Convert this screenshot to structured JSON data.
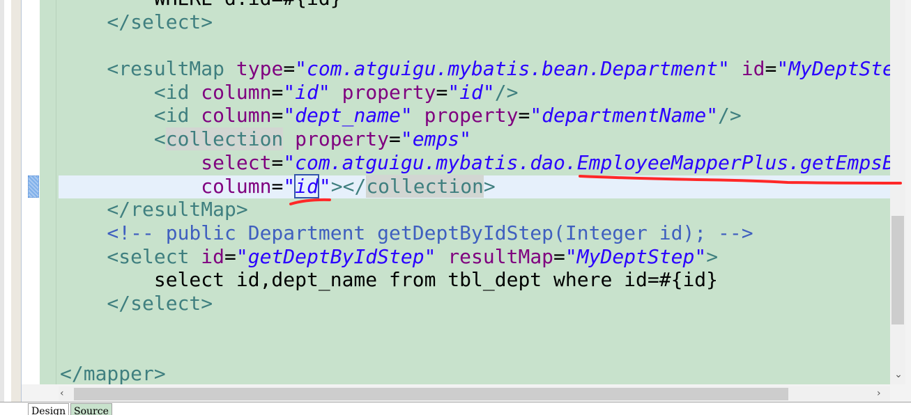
{
  "editor": {
    "lines": [
      [
        {
          "t": "        WHERE d.id=#{id}",
          "c": "txt"
        }
      ],
      [
        {
          "t": "    </select>",
          "c": "tag"
        }
      ],
      [],
      [
        {
          "t": "    <resultMap ",
          "c": "tag"
        },
        {
          "t": "type",
          "c": "attr"
        },
        {
          "t": "=",
          "c": "txt"
        },
        {
          "t": "\"com.atguigu.mybatis.bean.Department\"",
          "c": "val"
        },
        {
          "t": " ",
          "c": "txt"
        },
        {
          "t": "id",
          "c": "attr"
        },
        {
          "t": "=",
          "c": "txt"
        },
        {
          "t": "\"MyDeptStep\">",
          "c": "val"
        }
      ],
      [
        {
          "t": "        <id ",
          "c": "tag"
        },
        {
          "t": "column",
          "c": "attr"
        },
        {
          "t": "=",
          "c": "txt"
        },
        {
          "t": "\"id\"",
          "c": "val"
        },
        {
          "t": " ",
          "c": "txt"
        },
        {
          "t": "property",
          "c": "attr"
        },
        {
          "t": "=",
          "c": "txt"
        },
        {
          "t": "\"id\"",
          "c": "val"
        },
        {
          "t": "/>",
          "c": "tag"
        }
      ],
      [
        {
          "t": "        <id ",
          "c": "tag"
        },
        {
          "t": "column",
          "c": "attr"
        },
        {
          "t": "=",
          "c": "txt"
        },
        {
          "t": "\"dept_name\"",
          "c": "val"
        },
        {
          "t": " ",
          "c": "txt"
        },
        {
          "t": "property",
          "c": "attr"
        },
        {
          "t": "=",
          "c": "txt"
        },
        {
          "t": "\"departmentName\"",
          "c": "val"
        },
        {
          "t": "/>",
          "c": "tag"
        }
      ],
      [
        {
          "t": "        <",
          "c": "tag"
        },
        {
          "t": "collection",
          "c": "tag hl"
        },
        {
          "t": " ",
          "c": "txt"
        },
        {
          "t": "property",
          "c": "attr"
        },
        {
          "t": "=",
          "c": "txt"
        },
        {
          "t": "\"emps\"",
          "c": "val"
        }
      ],
      [
        {
          "t": "            ",
          "c": "txt"
        },
        {
          "t": "select",
          "c": "attr"
        },
        {
          "t": "=",
          "c": "txt"
        },
        {
          "t": "\"com.atguigu.mybatis.dao.EmployeeMapperPlus.getEmpsByDeptId\"",
          "c": "val"
        }
      ],
      [
        {
          "t": "            ",
          "c": "txt"
        },
        {
          "t": "column",
          "c": "attr"
        },
        {
          "t": "=",
          "c": "txt"
        },
        {
          "t": "\"",
          "c": "val"
        },
        {
          "t": "id",
          "c": "val box"
        },
        {
          "t": "|",
          "c": "caret"
        },
        {
          "t": "\"",
          "c": "val"
        },
        {
          "t": "></",
          "c": "tag"
        },
        {
          "t": "collection",
          "c": "tag hl"
        },
        {
          "t": ">",
          "c": "tag"
        }
      ],
      [
        {
          "t": "    </resultMap>",
          "c": "tag"
        }
      ],
      [
        {
          "t": "    <!-- public Department getDeptByIdStep(Integer id); -->",
          "c": "cmt"
        }
      ],
      [
        {
          "t": "    <select ",
          "c": "tag"
        },
        {
          "t": "id",
          "c": "attr"
        },
        {
          "t": "=",
          "c": "txt"
        },
        {
          "t": "\"getDeptByIdStep\"",
          "c": "val"
        },
        {
          "t": " ",
          "c": "txt"
        },
        {
          "t": "resultMap",
          "c": "attr"
        },
        {
          "t": "=",
          "c": "txt"
        },
        {
          "t": "\"MyDeptStep\"",
          "c": "val"
        },
        {
          "t": ">",
          "c": "tag"
        }
      ],
      [
        {
          "t": "        select id,dept_name from tbl_dept where id=#{id}",
          "c": "txt"
        }
      ],
      [
        {
          "t": "    </select>",
          "c": "tag"
        }
      ],
      [],
      [],
      [
        {
          "t": "</mapper>",
          "c": "tag"
        }
      ]
    ],
    "current_line": 8
  },
  "tabs": [
    {
      "label": "Design",
      "active": false
    },
    {
      "label": "Source",
      "active": true
    }
  ],
  "scrollbars": {
    "left_arrow": "‹",
    "right_arrow": "›",
    "down_arrow": "⌄"
  },
  "colors": {
    "background": "#c8e2cc",
    "tag": "#3f7f7f",
    "attribute": "#7f007f",
    "value": "#2a00ff",
    "comment": "#3f5fbf",
    "annotation": "#ff2020"
  }
}
